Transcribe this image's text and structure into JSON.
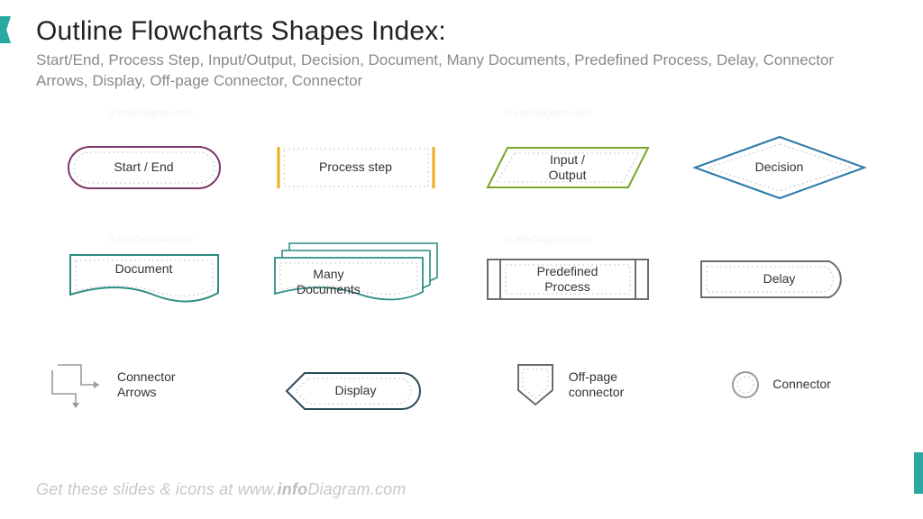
{
  "header": {
    "title": "Outline Flowcharts Shapes Index:",
    "subtitle": "Start/End, Process Step, Input/Output, Decision, Document, Many Documents, Predefined Process, Delay, Connector Arrows, Display, Off-page Connector, Connector"
  },
  "shapes": {
    "start_end": "Start / End",
    "process": "Process step",
    "io": "Input / Output",
    "decision": "Decision",
    "document": "Document",
    "many_docs": "Many Documents",
    "predefined": "Predefined Process",
    "delay": "Delay",
    "conn_arrows": "Connector Arrows",
    "display": "Display",
    "offpage": "Off-page connector",
    "connector": "Connector"
  },
  "colors": {
    "start_end": "#7a3a6e",
    "process": "#f0a81c",
    "io": "#7aa628",
    "decision": "#2a7aa8",
    "document": "#2e8c83",
    "many_docs": "#2e8c83",
    "predefined": "#6c6c6c",
    "delay": "#6c6c6c",
    "conn_arrows": "#9a9a9a",
    "display": "#2d4a5a",
    "offpage": "#6c6c6c",
    "connector": "#9a9a9a",
    "dotted": "#c8c8c8"
  },
  "footer": {
    "prefix": "Get these slides & icons at ",
    "site_prefix": "www.",
    "site_bold": "info",
    "site_rest": "Diagram.com"
  },
  "watermark": "© infoDiagram.com"
}
